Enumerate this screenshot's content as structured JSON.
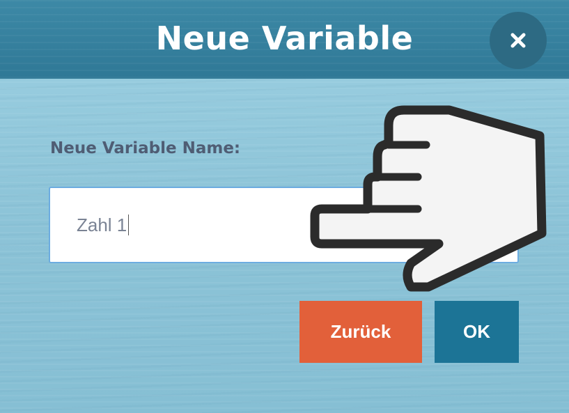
{
  "dialog": {
    "title": "Neue Variable",
    "close_icon": "close-icon"
  },
  "form": {
    "label": "Neue Variable Name:",
    "input_value": "Zahl 1"
  },
  "buttons": {
    "back_label": "Zurück",
    "ok_label": "OK"
  },
  "overlay": {
    "pointer_icon": "pointing-hand-icon"
  },
  "colors": {
    "header": "#2f7896",
    "background": "#8fc4d8",
    "back_button": "#e2603a",
    "ok_button": "#1c7496",
    "label_text": "#4f5d74"
  }
}
